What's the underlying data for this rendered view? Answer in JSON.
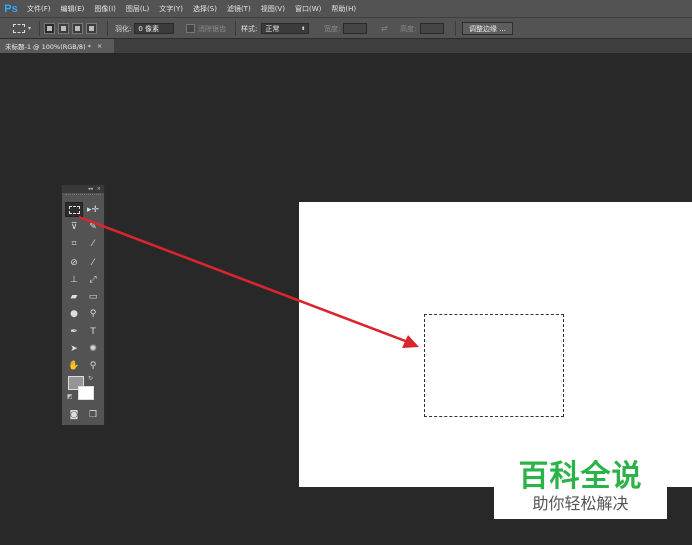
{
  "app": {
    "logo": "Ps"
  },
  "menu": [
    "文件(F)",
    "编辑(E)",
    "图像(I)",
    "图层(L)",
    "文字(Y)",
    "选择(S)",
    "滤镜(T)",
    "视图(V)",
    "窗口(W)",
    "帮助(H)"
  ],
  "options": {
    "feather_label": "羽化:",
    "feather_value": "0 像素",
    "antialias_label": "消除锯齿",
    "style_label": "样式:",
    "style_value": "正常",
    "width_label": "宽度:",
    "height_label": "高度:",
    "refine_button": "调整边缘 ..."
  },
  "document_tab": {
    "title": "未标题-1 @ 100%(RGB/8) *",
    "close": "×"
  },
  "toolbox": {
    "collapse": "◂◂",
    "close": "×"
  },
  "colors": {
    "foreground": "#959595",
    "background": "#ffffff",
    "annotation_arrow": "#d9252b",
    "watermark_green": "#2bb248"
  },
  "watermark": {
    "title": "百科全说",
    "subtitle": "助你轻松解决"
  }
}
